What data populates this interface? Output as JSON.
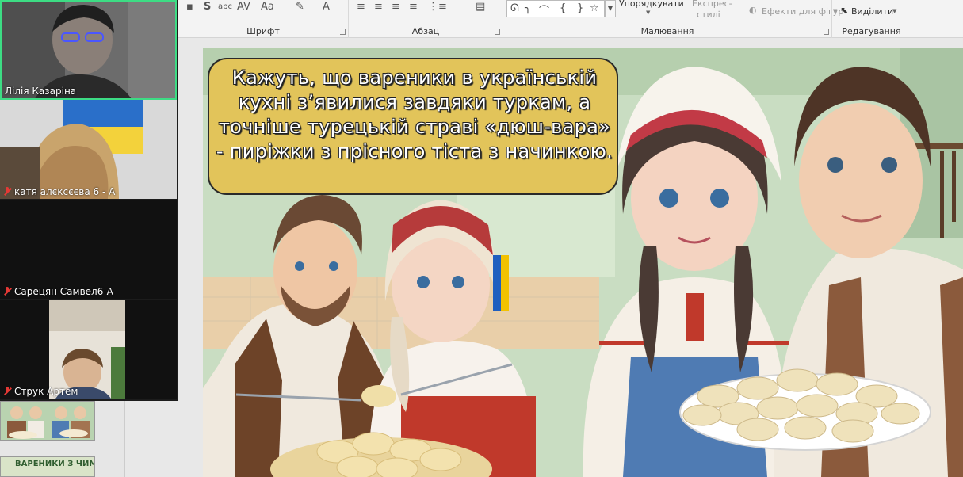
{
  "ribbon": {
    "groups": {
      "font": "Шрифт",
      "paragraph": "Абзац",
      "drawing": "Малювання",
      "editing": "Редагування"
    },
    "arrange_label": "Упорядкувати",
    "quick_styles_line1": "Експрес-",
    "quick_styles_line2": "стилі",
    "shape_effects_label": "Ефекти для фігур",
    "select_label": "Виділити",
    "shape_glyphs": [
      "ᘏ",
      "╮",
      "⌒",
      "{",
      "}",
      "☆"
    ]
  },
  "participants": [
    {
      "name": "Лілія Казаріна",
      "muted": false,
      "active": true
    },
    {
      "name": "катя алєксєєва 6 - А",
      "muted": true
    },
    {
      "name": "Сарецян Самвел6-А",
      "muted": true
    },
    {
      "name": "Струк Артем",
      "muted": true
    }
  ],
  "slide": {
    "callout_text": "Кажуть, що вареники в українській кухні з’явилися завдяки туркам, а точніше турецькій страві «дюш-вара» - пиріжки з прісного тіста з начинкою."
  },
  "thumbnail_title": "ВАРЕНИКИ З ЧИМ?",
  "colors": {
    "callout_fill": "#e2c45a",
    "active_speaker_border": "#3ddc84",
    "muted_mic": "#e53935"
  }
}
